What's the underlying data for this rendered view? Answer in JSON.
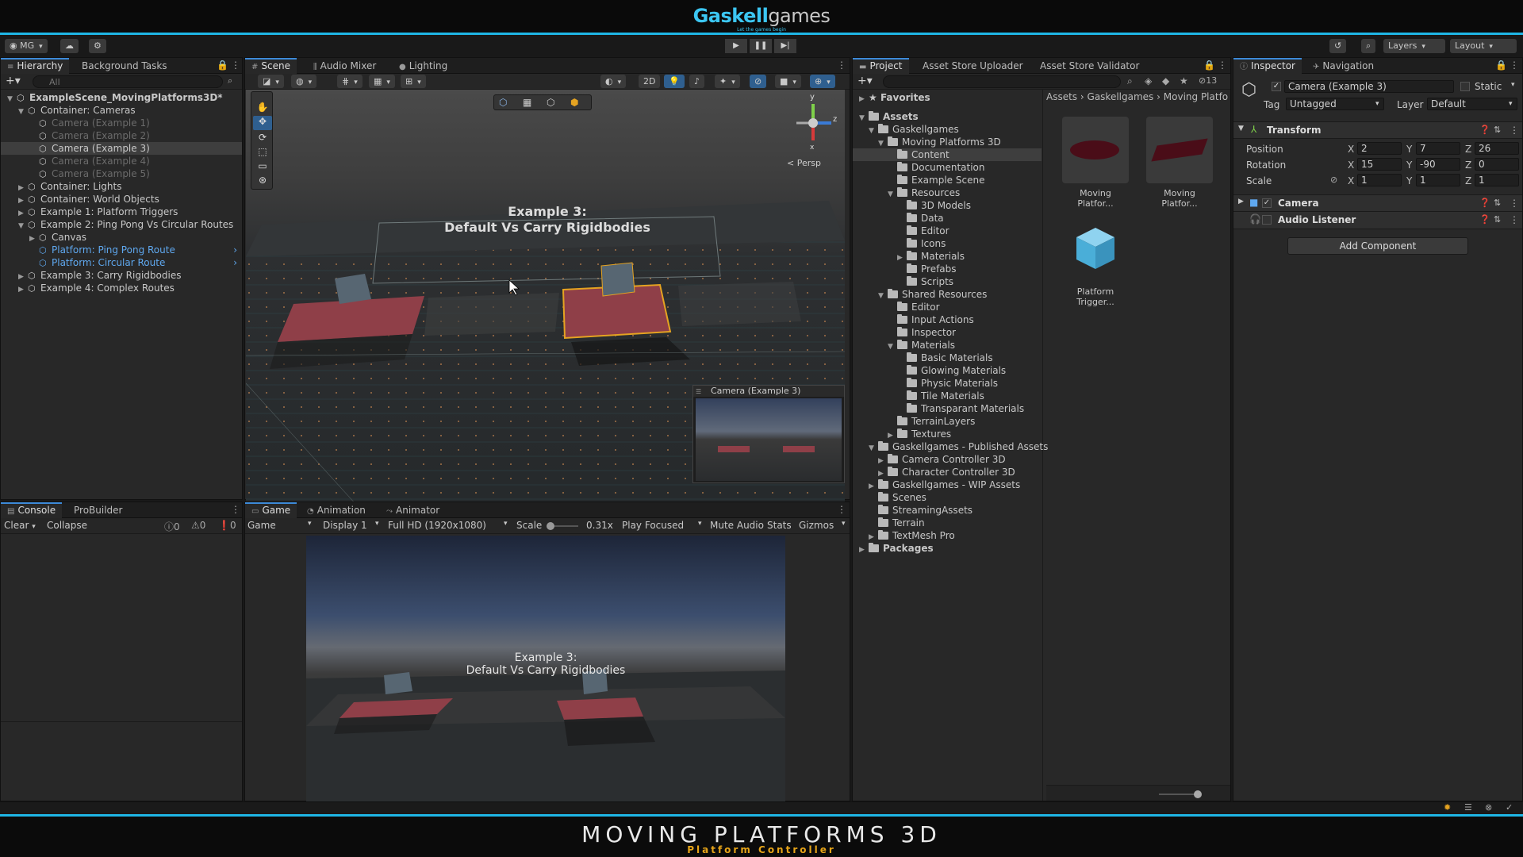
{
  "banner": {
    "brand_part1": "Gaskell",
    "brand_part2": "games",
    "tagline": "Let the games begin"
  },
  "toolbar": {
    "account": "MG",
    "layers": "Layers",
    "layout": "Layout"
  },
  "hierarchy": {
    "tabs": [
      "Hierarchy",
      "Background Tasks"
    ],
    "search_placeholder": "All",
    "items": [
      {
        "label": "ExampleScene_MovingPlatforms3D*",
        "level": 0,
        "arrow": "▼",
        "style": "bold"
      },
      {
        "label": "Container: Cameras",
        "level": 1,
        "arrow": "▼",
        "style": ""
      },
      {
        "label": "Camera (Example 1)",
        "level": 2,
        "arrow": "",
        "style": "dim"
      },
      {
        "label": "Camera (Example 2)",
        "level": 2,
        "arrow": "",
        "style": "dim"
      },
      {
        "label": "Camera (Example 3)",
        "level": 2,
        "arrow": "",
        "style": "sel"
      },
      {
        "label": "Camera (Example 4)",
        "level": 2,
        "arrow": "",
        "style": "dim"
      },
      {
        "label": "Camera (Example 5)",
        "level": 2,
        "arrow": "",
        "style": "dim"
      },
      {
        "label": "Container: Lights",
        "level": 1,
        "arrow": "▶",
        "style": ""
      },
      {
        "label": "Container: World Objects",
        "level": 1,
        "arrow": "▶",
        "style": ""
      },
      {
        "label": "Example 1: Platform Triggers",
        "level": 1,
        "arrow": "▶",
        "style": ""
      },
      {
        "label": "Example 2: Ping Pong Vs Circular Routes",
        "level": 1,
        "arrow": "▼",
        "style": ""
      },
      {
        "label": "Canvas",
        "level": 2,
        "arrow": "▶",
        "style": ""
      },
      {
        "label": "Platform: Ping Pong Route",
        "level": 2,
        "arrow": "",
        "style": "blue"
      },
      {
        "label": "Platform: Circular Route",
        "level": 2,
        "arrow": "",
        "style": "blue"
      },
      {
        "label": "Example 3: Carry Rigidbodies",
        "level": 1,
        "arrow": "▶",
        "style": ""
      },
      {
        "label": "Example 4: Complex Routes",
        "level": 1,
        "arrow": "▶",
        "style": ""
      }
    ]
  },
  "scene": {
    "tabs": [
      "Scene",
      "Audio Mixer",
      "Lighting"
    ],
    "mode_2d": "2D",
    "persp": "< Persp",
    "overlay_title_line1": "Example 3:",
    "overlay_title_line2": "Default Vs Carry Rigidbodies",
    "camera_preview_title": "Camera (Example 3)",
    "gizmo_axes": {
      "y": "y",
      "z": "z",
      "x": "x"
    }
  },
  "console": {
    "tabs": [
      "Console",
      "ProBuilder"
    ],
    "clear": "Clear",
    "collapse": "Collapse",
    "counts": [
      "0",
      "0",
      "0"
    ]
  },
  "game": {
    "tabs": [
      "Game",
      "Animation",
      "Animator"
    ],
    "view_select": "Game",
    "display": "Display 1",
    "resolution": "Full HD (1920x1080)",
    "scale_label": "Scale",
    "scale_value": "0.31x",
    "scale_fraction": 0.05,
    "play_focused": "Play Focused",
    "mute": "Mute Audio",
    "stats": "Stats",
    "gizmos": "Gizmos",
    "overlay_line1": "Example 3:",
    "overlay_line2": "Default Vs Carry Rigidbodies"
  },
  "project": {
    "tabs": [
      "Project",
      "Asset Store Uploader",
      "Asset Store Validator"
    ],
    "count_badge": "13",
    "favorites": "Favorites",
    "breadcrumb": [
      "Assets",
      "Gaskellgames",
      "Moving Platfo"
    ],
    "tree": [
      {
        "label": "Assets",
        "level": 0,
        "arrow": "▼",
        "bold": true
      },
      {
        "label": "Gaskellgames",
        "level": 1,
        "arrow": "▼"
      },
      {
        "label": "Moving Platforms 3D",
        "level": 2,
        "arrow": "▼"
      },
      {
        "label": "Content",
        "level": 3,
        "arrow": "",
        "sel": true
      },
      {
        "label": "Documentation",
        "level": 3,
        "arrow": ""
      },
      {
        "label": "Example Scene",
        "level": 3,
        "arrow": ""
      },
      {
        "label": "Resources",
        "level": 3,
        "arrow": "▼"
      },
      {
        "label": "3D Models",
        "level": 4,
        "arrow": ""
      },
      {
        "label": "Data",
        "level": 4,
        "arrow": ""
      },
      {
        "label": "Editor",
        "level": 4,
        "arrow": ""
      },
      {
        "label": "Icons",
        "level": 4,
        "arrow": ""
      },
      {
        "label": "Materials",
        "level": 4,
        "arrow": "▶"
      },
      {
        "label": "Prefabs",
        "level": 4,
        "arrow": ""
      },
      {
        "label": "Scripts",
        "level": 4,
        "arrow": ""
      },
      {
        "label": "Shared Resources",
        "level": 2,
        "arrow": "▼"
      },
      {
        "label": "Editor",
        "level": 3,
        "arrow": ""
      },
      {
        "label": "Input Actions",
        "level": 3,
        "arrow": ""
      },
      {
        "label": "Inspector",
        "level": 3,
        "arrow": ""
      },
      {
        "label": "Materials",
        "level": 3,
        "arrow": "▼"
      },
      {
        "label": "Basic Materials",
        "level": 4,
        "arrow": ""
      },
      {
        "label": "Glowing Materials",
        "level": 4,
        "arrow": ""
      },
      {
        "label": "Physic Materials",
        "level": 4,
        "arrow": ""
      },
      {
        "label": "Tile Materials",
        "level": 4,
        "arrow": ""
      },
      {
        "label": "Transparant Materials",
        "level": 4,
        "arrow": ""
      },
      {
        "label": "TerrainLayers",
        "level": 3,
        "arrow": ""
      },
      {
        "label": "Textures",
        "level": 3,
        "arrow": "▶"
      },
      {
        "label": "Gaskellgames - Published Assets",
        "level": 1,
        "arrow": "▼"
      },
      {
        "label": "Camera Controller 3D",
        "level": 2,
        "arrow": "▶"
      },
      {
        "label": "Character Controller 3D",
        "level": 2,
        "arrow": "▶"
      },
      {
        "label": "Gaskellgames - WIP Assets",
        "level": 1,
        "arrow": "▶"
      },
      {
        "label": "Scenes",
        "level": 1,
        "arrow": ""
      },
      {
        "label": "StreamingAssets",
        "level": 1,
        "arrow": ""
      },
      {
        "label": "Terrain",
        "level": 1,
        "arrow": ""
      },
      {
        "label": "TextMesh Pro",
        "level": 1,
        "arrow": "▶"
      },
      {
        "label": "Packages",
        "level": 0,
        "arrow": "▶",
        "bold": true
      }
    ],
    "assets": [
      "Moving Platfor...",
      "Moving Platfor...",
      "Platform Trigger..."
    ]
  },
  "inspector": {
    "tabs": [
      "Inspector",
      "Navigation"
    ],
    "object_name": "Camera (Example 3)",
    "static_label": "Static",
    "tag_label": "Tag",
    "tag_value": "Untagged",
    "layer_label": "Layer",
    "layer_value": "Default",
    "transform": {
      "title": "Transform",
      "position": {
        "label": "Position",
        "x": "2",
        "y": "7",
        "z": "26"
      },
      "rotation": {
        "label": "Rotation",
        "x": "15",
        "y": "-90",
        "z": "0"
      },
      "scale": {
        "label": "Scale",
        "x": "1",
        "y": "1",
        "z": "1"
      }
    },
    "components": [
      "Camera",
      "Audio Listener"
    ],
    "add_component": "Add Component",
    "axis_labels": {
      "x": "X",
      "y": "Y",
      "z": "Z"
    }
  },
  "footer": {
    "title": "MOVING PLATFORMS 3D",
    "subtitle": "Platform Controller"
  },
  "colors": {
    "accent": "#1fb6e6",
    "selection": "#3e3e3e",
    "prefab_blue": "#5fa8ef",
    "footer_sub": "#e6a418"
  }
}
